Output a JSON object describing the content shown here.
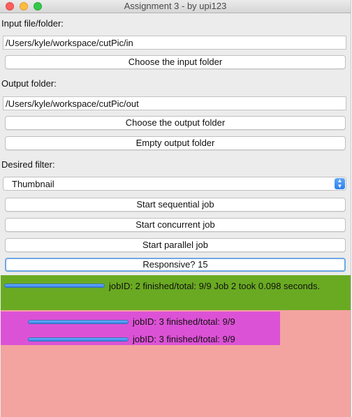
{
  "window": {
    "title": "Assignment 3 - by upi123"
  },
  "input": {
    "label": "Input file/folder:",
    "value": "/Users/kyle/workspace/cutPic/in",
    "choose_button": "Choose the input folder"
  },
  "output": {
    "label": "Output folder:",
    "value": "/Users/kyle/workspace/cutPic/out",
    "choose_button": "Choose the output folder",
    "empty_button": "Empty output folder"
  },
  "filter": {
    "label": "Desired filter:",
    "selected": "Thumbnail",
    "arrow_up": "▲",
    "arrow_down": "▼"
  },
  "actions": {
    "sequential": "Start sequential job",
    "concurrent": "Start concurrent job",
    "parallel": "Start parallel job",
    "responsive": "Responsive? 15"
  },
  "jobs": [
    {
      "text": "jobID: 2 finished/total: 9/9 Job 2 took 0.098 seconds.",
      "progress": 1.0,
      "color": "#6aaa22"
    },
    {
      "text": "jobID: 3 finished/total: 9/9",
      "progress": 1.0,
      "color": "#dc52d6"
    },
    {
      "text": "jobID: 3 finished/total: 9/9",
      "progress": 1.0,
      "color": "#dc52d6"
    }
  ],
  "colors": {
    "green_panel": "#6aaa22",
    "magenta_panel": "#dc52d6",
    "pink_panel": "#f3a3a0"
  }
}
